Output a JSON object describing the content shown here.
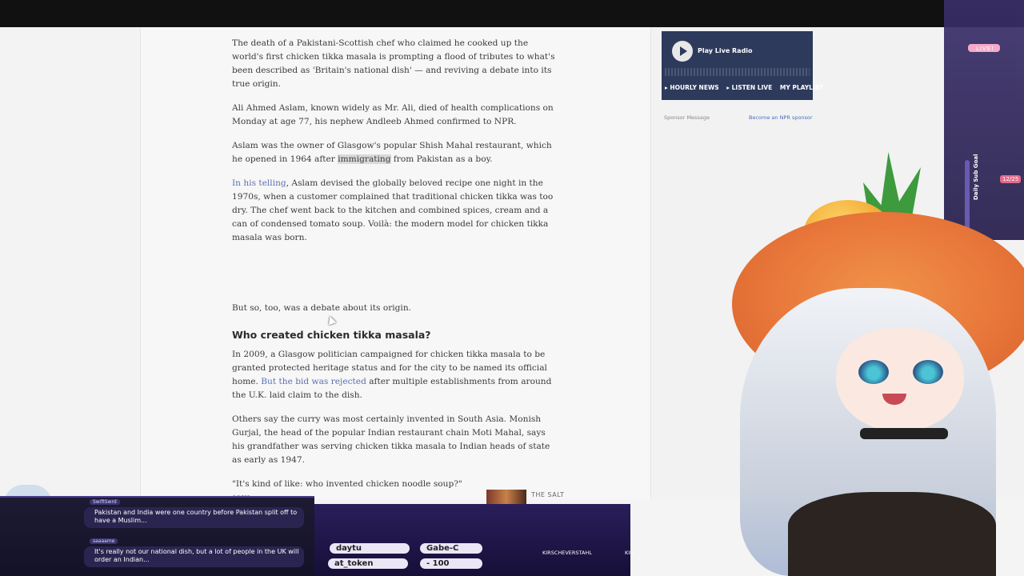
{
  "article": {
    "paragraphs": [
      "The death of a Pakistani-Scottish chef who claimed he cooked up the world's first chicken tikka masala is prompting a flood of tributes to what's been described as 'Britain's national dish' — and reviving a debate into its true origin.",
      "Ali Ahmed Aslam, known widely as Mr. Ali, died of health complications on Monday at age 77, his nephew Andleeb Ahmed confirmed to NPR."
    ],
    "p3_before": "Aslam was the owner of Glasgow's popular Shish Mahal restaurant, which he opened in 1964 after ",
    "p3_highlight": "immigrating",
    "p3_after": " from Pakistan as a boy.",
    "p4_link": "In his telling",
    "p4_rest": ", Aslam devised the globally beloved recipe one night in the 1970s, when a customer complained that traditional chicken tikka was too dry. The chef went back to the kitchen and combined spices, cream and a can of condensed tomato soup. Voilà: the modern model for chicken tikka masala was born.",
    "p5": "But so, too, was a debate about its origin.",
    "heading": "Who created chicken tikka masala?",
    "p6_before": "In 2009, a Glasgow politician campaigned for chicken tikka masala to be granted protected heritage status and for the city to be named its official home. ",
    "p6_link": "But the bid was rejected",
    "p6_after": " after multiple establishments from around the U.K. laid claim to the dish.",
    "p7": "Others say the curry was most certainly invented in South Asia. Monish Gurjal, the head of the popular Indian restaurant chain Moti Mahal, says his grandfather was serving chicken tikka masala to Indian heads of state as early as 1947.",
    "p8": "\"It's kind of like: who invented chicken noodle soup?\" says",
    "salt_label": "THE SALT"
  },
  "rail": {
    "radio_title": "Play Live Radio",
    "links": [
      "▸ HOURLY NEWS",
      "▸ LISTEN LIVE",
      "MY PLAYLIST"
    ],
    "sponsor_left": "Sponsor Message",
    "sponsor_right": "Become an NPR sponsor"
  },
  "overlay": {
    "live": "LIVE!",
    "subgoal": "Daily Sub Goal",
    "goal_count": "12/25",
    "chat": [
      {
        "user": "SwiftSwrd",
        "text": "Pakistan and India were one country before Pakistan split off to have a Muslim..."
      },
      {
        "user": "saaaame",
        "text": "It's really not our national dish, but a lot of people in the UK will order an Indian..."
      }
    ],
    "pills": [
      "daytu",
      "Gabe-C",
      "at_token",
      "- 100"
    ],
    "credits": [
      "KIRSCHEVERSTAHL",
      "KIR"
    ]
  }
}
